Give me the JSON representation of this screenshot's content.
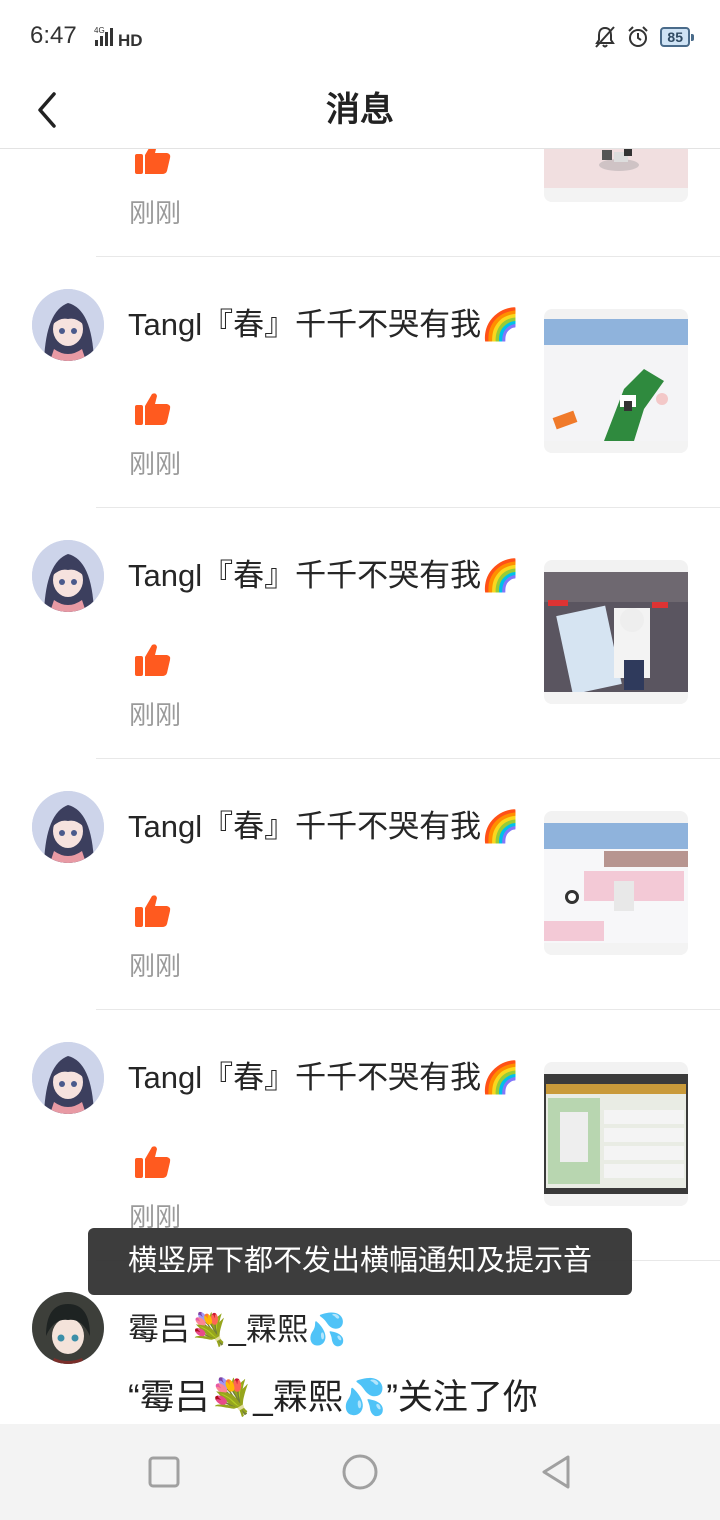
{
  "status_bar": {
    "time": "6:47",
    "network_label": "4G HD",
    "battery": "85",
    "icons": [
      "mute-bell-icon",
      "alarm-icon",
      "battery-icon",
      "signal-icon"
    ]
  },
  "header": {
    "back_icon": "chevron-left-icon",
    "title": "消息"
  },
  "messages": [
    {
      "sender": "",
      "sender_emoji": "",
      "time": "刚刚",
      "like_icon": "thumbs-up-icon"
    },
    {
      "sender": "Tangl『春』千千不哭有我",
      "sender_emoji": "🌈",
      "time": "刚刚",
      "like_icon": "thumbs-up-icon"
    },
    {
      "sender": "Tangl『春』千千不哭有我",
      "sender_emoji": "🌈",
      "time": "刚刚",
      "like_icon": "thumbs-up-icon"
    },
    {
      "sender": "Tangl『春』千千不哭有我",
      "sender_emoji": "🌈",
      "time": "刚刚",
      "like_icon": "thumbs-up-icon"
    },
    {
      "sender": "Tangl『春』千千不哭有我",
      "sender_emoji": "🌈",
      "time": "刚刚",
      "like_icon": "thumbs-up-icon"
    }
  ],
  "follow_item": {
    "name_parts": [
      "霉吕",
      "💐",
      "_霖熙",
      "💦"
    ],
    "text": "“霉吕💐_霖熙💦”关注了你"
  },
  "toast": "横竖屏下都不发出横幅通知及提示音",
  "colors": {
    "like_orange": "#ff5a1f",
    "time_gray": "#9a9a9a",
    "toast_bg": "#2d2d2d"
  },
  "nav_bar": {
    "icons": [
      "square-recent-icon",
      "circle-home-icon",
      "triangle-back-icon"
    ]
  }
}
